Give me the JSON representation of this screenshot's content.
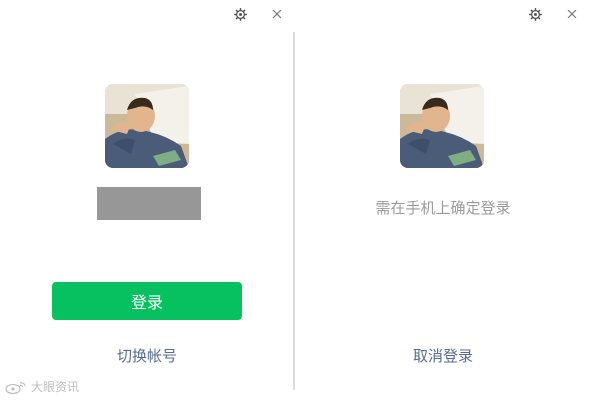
{
  "left_panel": {
    "login_button_label": "登录",
    "switch_account_label": "切换帐号"
  },
  "right_panel": {
    "hint_text": "需在手机上确定登录",
    "cancel_login_label": "取消登录"
  },
  "window_icons": [
    "settings-icon",
    "close-icon"
  ],
  "watermark": {
    "text": "大眼资讯"
  },
  "colors": {
    "primary_green": "#07c160",
    "link_blue": "#576b95",
    "hint_gray": "#9a9a9a",
    "masked_name_gray": "#979797"
  }
}
